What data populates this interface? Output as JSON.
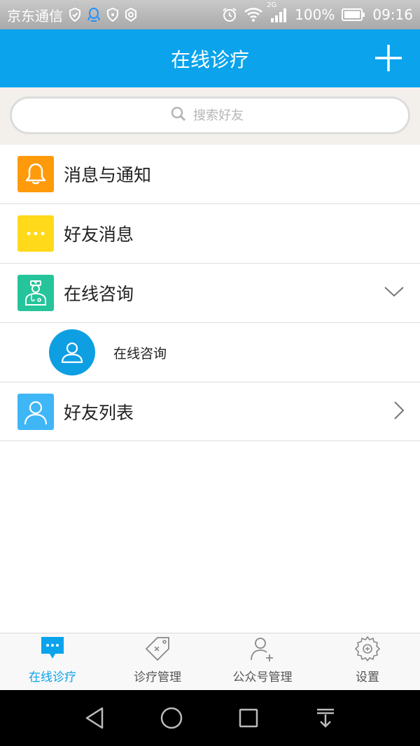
{
  "statusbar": {
    "carrier": "京东通信",
    "network": "2G",
    "battery": "100%",
    "time": "09:16"
  },
  "header": {
    "title": "在线诊疗",
    "add_icon": "plus-icon"
  },
  "search": {
    "placeholder": "搜索好友"
  },
  "list": {
    "items": [
      {
        "label": "消息与通知",
        "icon": "bell-icon",
        "color": "#ff9a0a"
      },
      {
        "label": "好友消息",
        "icon": "chat-dots-icon",
        "color": "#ffd91a"
      },
      {
        "label": "在线咨询",
        "icon": "doctor-icon",
        "color": "#25c49b",
        "expanded": true
      },
      {
        "label": "好友列表",
        "icon": "user-icon",
        "color": "#3fb6f6"
      }
    ],
    "sub_items": [
      {
        "label": "在线咨询",
        "icon": "user-avatar-icon"
      }
    ]
  },
  "tabbar": {
    "tabs": [
      {
        "label": "在线诊疗",
        "icon": "chat-bubble-icon",
        "active": true
      },
      {
        "label": "诊疗管理",
        "icon": "tag-icon",
        "active": false
      },
      {
        "label": "公众号管理",
        "icon": "add-user-icon",
        "active": false
      },
      {
        "label": "设置",
        "icon": "gear-icon",
        "active": false
      }
    ]
  },
  "colors": {
    "primary": "#0aa3ec",
    "active_tab": "#0aa3ec"
  }
}
